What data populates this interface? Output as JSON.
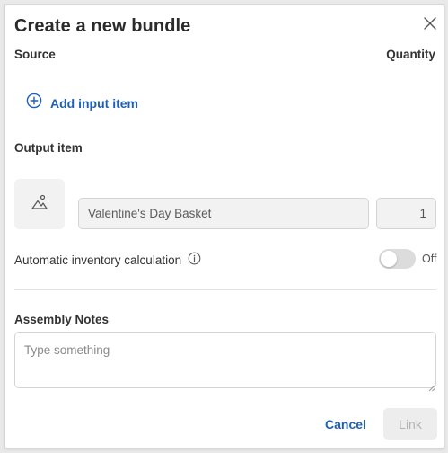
{
  "dialog": {
    "title": "Create a new bundle",
    "close_icon": "close-icon"
  },
  "source": {
    "label": "Source",
    "quantity_label": "Quantity",
    "add_input_label": "Add input item",
    "add_icon": "plus-circle-icon"
  },
  "output": {
    "label": "Output item",
    "image_icon": "image-placeholder-icon",
    "item_name": "Valentine's Day Basket",
    "quantity": "1"
  },
  "auto_inventory": {
    "label": "Automatic inventory calculation",
    "info_icon": "info-icon",
    "toggle_state": "Off"
  },
  "notes": {
    "label": "Assembly Notes",
    "placeholder": "Type something"
  },
  "actions": {
    "cancel_label": "Cancel",
    "link_label": "Link"
  },
  "colors": {
    "accent": "#1f5fb8",
    "disabled_bg": "#ededed",
    "disabled_text": "#b3b3b3",
    "field_bg": "#f2f2f2"
  }
}
